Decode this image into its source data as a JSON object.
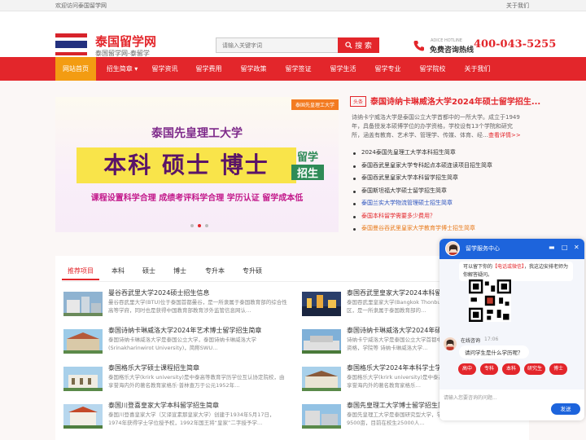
{
  "topbar": {
    "welcome": "欢迎访问泰国留学网",
    "about": "关于我们"
  },
  "header": {
    "site_name": "泰国留学网",
    "site_sub": "泰国留学网-泰留学",
    "search_placeholder": "请输入关键字词",
    "search_label": "搜 索",
    "hotline_small": "ADICE HOTLINE",
    "hotline_label": "免费咨询热线",
    "hotline_number": "400-043-5255",
    "flag_colors": [
      "#d7232b",
      "#ffffff",
      "#23317f",
      "#ffffff",
      "#d7232b"
    ]
  },
  "nav": {
    "items": [
      "网站首页",
      "招生简章",
      "留学资讯",
      "留学费用",
      "留学政策",
      "留学签证",
      "留学生活",
      "留学专业",
      "留学院校",
      "关于我们"
    ],
    "dropdown_marker": "▾",
    "active_color": "#f39c12",
    "bar_color": "#e3262b"
  },
  "banner": {
    "tag": "泰国先皇理工大学",
    "title": "泰国先皇理工大学",
    "big_text": "本科 硕士 博士",
    "badge_line1": "留学",
    "badge_line2": "招生",
    "slogan": "课程设置科学合理  成绩考评科学合理  学历认证  留学成本低"
  },
  "headline": {
    "tag": "头条",
    "title": "泰国诗纳卡琳威洛大学2024年硕士留学招生...",
    "desc": "诗纳卡宁威洛大学是泰国公立大学首都中的一所大学。成立于1949年，具备授发本硕博学位的办学资格，学校设有13个学院和研究所，涵盖有教育、艺术学、管理学、传媒、体育、经…",
    "more": "查看详情>>"
  },
  "news": [
    {
      "text": "2024泰国先皇理工大学本科招生简章",
      "style": ""
    },
    {
      "text": "泰国吞武里皇家大学专科起点本硕连读项目招生简章",
      "style": ""
    },
    {
      "text": "泰国吞武里皇家大学本科留学招生简章",
      "style": ""
    },
    {
      "text": "泰国斯坦福大学硕士留学招生简章",
      "style": ""
    },
    {
      "text": "泰国兰实大学物流管理硕士招生简章",
      "style": "c-blue"
    },
    {
      "text": "泰国本科留学需要多少费用？",
      "style": "c-red"
    },
    {
      "text": "泰国曼谷吞武里皇家大学教育学博士招生简章",
      "style": "c-orange"
    }
  ],
  "tabs": [
    "推荐项目",
    "本科",
    "硕士",
    "博士",
    "专升本",
    "专升硕"
  ],
  "cards": [
    {
      "title": "曼谷吞武里大学2024硕士招生信息",
      "desc": "曼谷吞武里大学(BTU)位于泰国首都曼谷，是一所隶属于泰国教育部的综合性高等学府，同时也是获得中国教育部教育涉外监管信息网认…"
    },
    {
      "title": "泰国吞武里皇家大学2024本科留学项目",
      "desc": "泰国吞武里皇家大学(Bangkok Thonburi U)，位于泰国首都曼谷吞武里区，是一所隶属于泰国教育部的…"
    },
    {
      "title": "泰国诗纳卡琳威洛大学2024年艺术博士留学招生简章",
      "desc": "泰国诗纳卡琳威洛大学是泰国公立大学，泰国诗纳卡琳威洛大学(Srinakharinwirot University)，简称SWU…"
    },
    {
      "title": "泰国诗纳卡琳威洛大学2024年硕士留学",
      "desc": "诗纳卡宁威洛大学是泰国公立大学首都中的一所大学，具备授发本硕博学位资格，学院等 诗纳卡琳威洛大学…"
    },
    {
      "title": "泰国格乐大学硕士课程招生简章",
      "desc": "泰国格乐大学(krirk university)是中泰高等教育学历学位互认协定院校，由享誉海内外的著名教育家格乐·普林查万于公元1952年…"
    },
    {
      "title": "泰国格乐大学2024年本科学士学位专业招生",
      "desc": "泰国格乐大学(krirk university)是中泰高等教育学历学位互认协定院校，由享誉海内外的著名教育家格乐…"
    },
    {
      "title": "泰国川登喜皇家大学本科留学招生简章",
      "desc": "泰国川登喜皇家大学（又译宣素那皇家大学）创建于1934年5月17日，1974年获得学士学位授予权，1992年国王将“皇家”二字授予学…"
    },
    {
      "title": "泰国先皇理工大学博士留学招生简章",
      "desc": "泰国先皇理工大学是泰国研究型大学，学校位于泰国首都曼谷，占地面积约9500亩，目前在校生25000人…"
    }
  ],
  "chat": {
    "title": "留学服务中心",
    "intro_prefix": "可以留下你的",
    "intro_highlight": "【电话或微信】",
    "intro_suffix": "，我这边安排老师为你解答疑问。",
    "agent_name": "在线咨询",
    "agent_time": "17:06",
    "question": "请问学生是什么学历呢？",
    "options": [
      "高中",
      "专科",
      "本科",
      "研究生",
      "博士"
    ],
    "input_placeholder": "请输入您要咨询的问题...",
    "send_label": "发送",
    "header_color": "#1d64dc"
  }
}
